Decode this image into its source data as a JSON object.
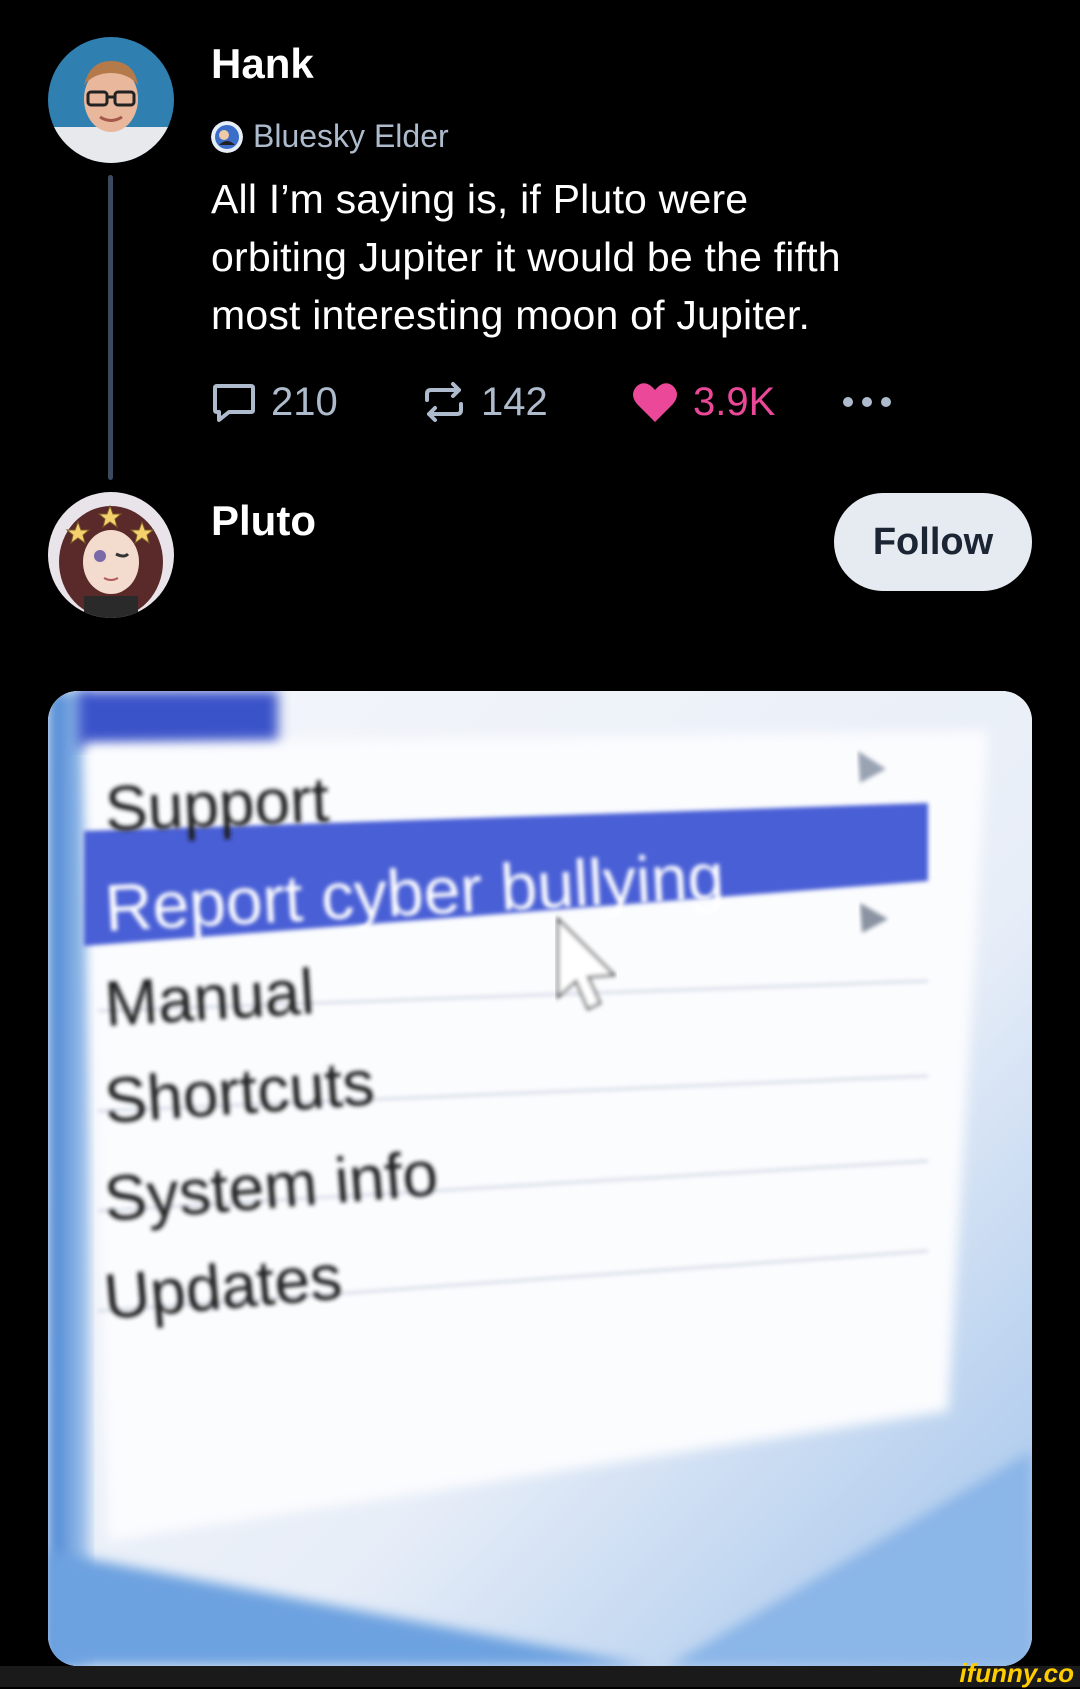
{
  "posts": [
    {
      "author": "Hank",
      "badge": "Bluesky Elder",
      "text_lines": [
        "All I’m saying is, if Pluto were",
        "orbiting Jupiter it would be the fifth",
        "most interesting moon of Jupiter."
      ],
      "replies": "210",
      "reposts": "142",
      "likes": "3.9K"
    },
    {
      "author": "Pluto",
      "follow_label": "Follow"
    }
  ],
  "media_menu": {
    "items": [
      "Support",
      "Report cyber bullying",
      "Manual",
      "Shortcuts",
      "System info",
      "Updates"
    ],
    "highlight_color": "#4a5fd6"
  },
  "colors": {
    "background": "#000000",
    "like_accent": "#ec4899",
    "muted_text": "#aebbcc",
    "thread_line": "#3b4a5e",
    "follow_bg": "#e6ebf2"
  },
  "watermark": "ifunny.co"
}
